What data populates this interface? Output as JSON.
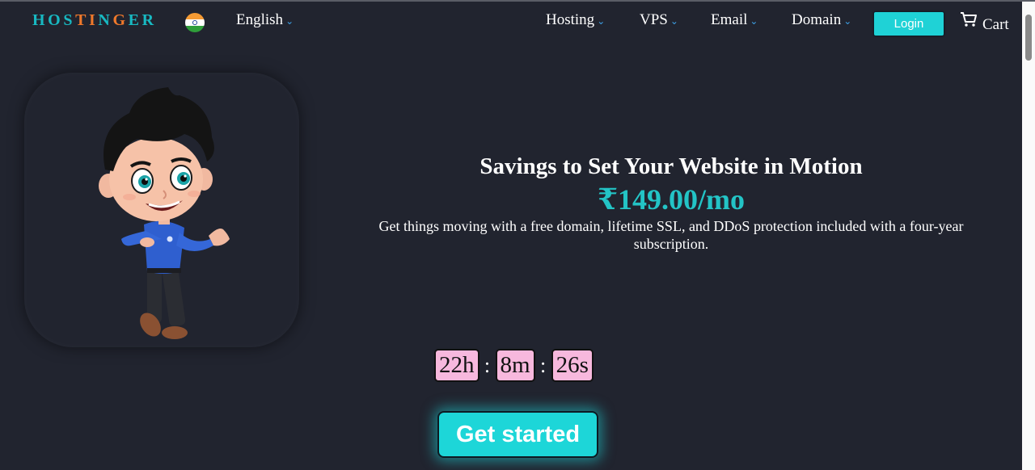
{
  "brand": {
    "logo_letters": [
      {
        "ch": "H",
        "color": "#18b9c2"
      },
      {
        "ch": "O",
        "color": "#18b9c2"
      },
      {
        "ch": "S",
        "color": "#18b9c2"
      },
      {
        "ch": "T",
        "color": "#f0792b"
      },
      {
        "ch": "I",
        "color": "#f0792b"
      },
      {
        "ch": "N",
        "color": "#18b9c2"
      },
      {
        "ch": "G",
        "color": "#f0792b"
      },
      {
        "ch": "E",
        "color": "#18b9c2"
      },
      {
        "ch": "R",
        "color": "#18b9c2"
      }
    ],
    "flag_icon": "india-flag-icon"
  },
  "nav": {
    "language": "English",
    "items": [
      {
        "label": "Hosting"
      },
      {
        "label": "VPS"
      },
      {
        "label": "Email"
      },
      {
        "label": "Domain"
      }
    ],
    "login_label": "Login",
    "cart_label": "Cart",
    "cart_icon": "cart-icon",
    "chevron_icon": "chevron-down-icon"
  },
  "hero": {
    "headline": "Savings to Set Your Website in Motion",
    "price": "₹149.00/mo",
    "description": "Get things moving with a free domain, lifetime SSL, and DDoS protection included with a four-year subscription.",
    "mascot": "cartoon-mascot-illustration"
  },
  "countdown": {
    "hours": "22h",
    "minutes": "8m",
    "seconds": "26s",
    "separator": ":"
  },
  "cta": {
    "label": "Get started"
  },
  "colors": {
    "background": "#21242f",
    "accent": "#1dd6d8",
    "price": "#23c4c6",
    "timer_box": "#f7b8dd",
    "chevron": "#3da0e6"
  }
}
